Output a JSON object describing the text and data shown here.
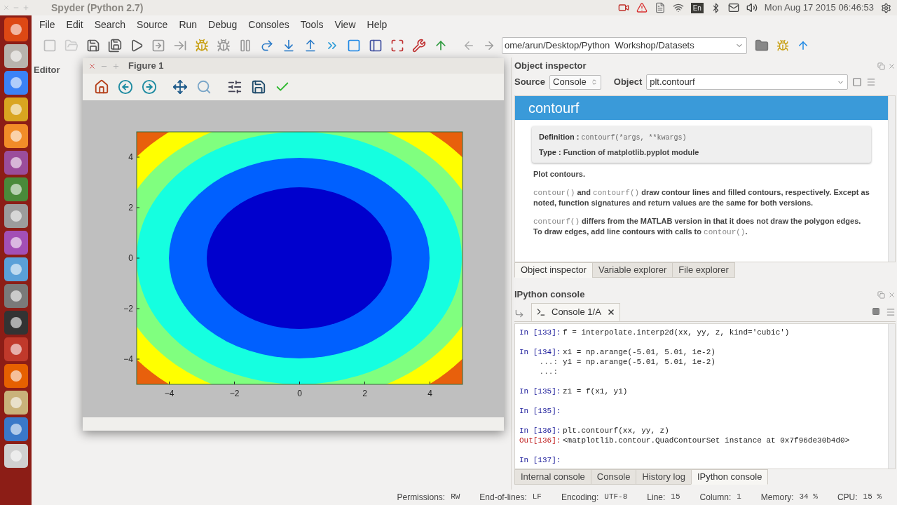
{
  "top_panel": {
    "window_title": "Spyder (Python 2.7)",
    "keyboard_layout": "En",
    "clock": "Mon Aug 17 2015 06:46:53"
  },
  "menu": [
    "File",
    "Edit",
    "Search",
    "Source",
    "Run",
    "Debug",
    "Consoles",
    "Tools",
    "View",
    "Help"
  ],
  "toolbar": {
    "path": "ome/arun/Desktop/Python  Workshop/Datasets"
  },
  "editor": {
    "title": "Editor"
  },
  "figure": {
    "title": "Figure 1",
    "xticks": [
      "−4",
      "−2",
      "0",
      "2",
      "4"
    ],
    "yticks": [
      "4",
      "2",
      "0",
      "−2",
      "−4"
    ]
  },
  "inspector": {
    "title": "Object inspector",
    "source_label": "Source",
    "source": "Console",
    "object_label": "Object",
    "object": "plt.contourf",
    "heading": "contourf",
    "definition_label": "Definition :",
    "definition": "contourf(*args, **kwargs)",
    "type_label": "Type :",
    "type": "Function of matplotlib.pyplot module",
    "paragraphs": [
      [
        {
          "kind": "text",
          "text": "Plot contours."
        }
      ],
      [
        {
          "kind": "code",
          "text": "contour()"
        },
        {
          "kind": "text",
          "text": " and "
        },
        {
          "kind": "code",
          "text": "contourf()"
        },
        {
          "kind": "text",
          "text": " draw contour lines and filled contours, respectively. Except as noted, function signatures and return values are the same for both versions."
        }
      ],
      [
        {
          "kind": "code",
          "text": "contourf()"
        },
        {
          "kind": "text",
          "text": " differs from the MATLAB version in that it does not draw the polygon edges. To draw edges, add line contours with calls to "
        },
        {
          "kind": "code",
          "text": "contour()"
        },
        {
          "kind": "text",
          "text": "."
        }
      ]
    ],
    "tabs": [
      {
        "label": "Object inspector",
        "selected": true
      },
      {
        "label": "Variable explorer",
        "selected": false
      },
      {
        "label": "File explorer",
        "selected": false
      }
    ]
  },
  "console": {
    "title": "IPython console",
    "tab": "Console 1/A",
    "blocks": [
      [
        {
          "kind": "in",
          "prompt": "In [133]:",
          "code": "f = interpolate.interp2d(xx, yy, z, kind='cubic')"
        }
      ],
      [
        {
          "kind": "in",
          "prompt": "In [134]:",
          "code": "x1 = np.arange(-5.01, 5.01, 1e-2)"
        },
        {
          "kind": "cont",
          "prompt": "...:",
          "code": "y1 = np.arange(-5.01, 5.01, 1e-2)"
        },
        {
          "kind": "cont",
          "prompt": "...:"
        }
      ],
      [
        {
          "kind": "in",
          "prompt": "In [135]:",
          "code": "z1 = f(x1, y1)"
        }
      ],
      [
        {
          "kind": "in",
          "prompt": "In [135]:"
        }
      ],
      [
        {
          "kind": "in",
          "prompt": "In [136]:",
          "code": "plt.contourf(xx, yy, z)"
        },
        {
          "kind": "out",
          "prompt": "Out[136]:",
          "code": "<matplotlib.contour.QuadContourSet instance at 0x7f96de30b4d0>"
        }
      ],
      [
        {
          "kind": "in",
          "prompt": "In [137]:"
        }
      ]
    ],
    "tabs": [
      {
        "label": "Internal console",
        "selected": false
      },
      {
        "label": "Console",
        "selected": false
      },
      {
        "label": "History log",
        "selected": false
      },
      {
        "label": "IPython console",
        "selected": true
      }
    ]
  },
  "status_bar": [
    {
      "label": "Permissions:",
      "value": "RW"
    },
    {
      "label": "End-of-lines:",
      "value": "LF"
    },
    {
      "label": "Encoding:",
      "value": "UTF-8"
    },
    {
      "label": "Line:",
      "value": "15"
    },
    {
      "label": "Column:",
      "value": "1"
    },
    {
      "label": "Memory:",
      "value": "34 %"
    },
    {
      "label": "CPU:",
      "value": "15 %"
    }
  ]
}
